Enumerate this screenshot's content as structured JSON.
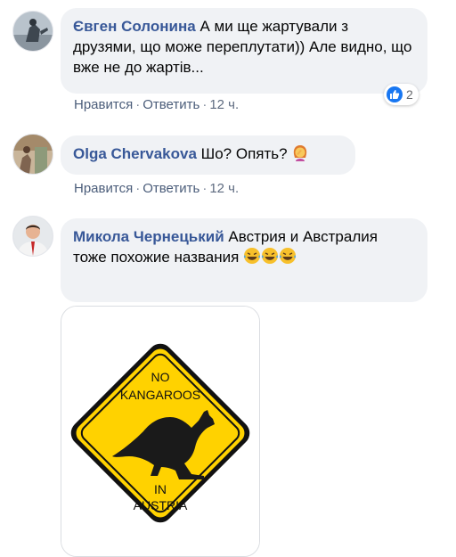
{
  "comments": [
    {
      "author": "Євген Солонина",
      "text": "А ми ще жартували з друзями, що може переплутати)) Але видно, що вже не до жартів...",
      "like_label": "Нравится",
      "reply_label": "Ответить",
      "time": "12 ч.",
      "reaction_count": "2",
      "reaction_icon": "like-icon"
    },
    {
      "author": "Olga Chervakova",
      "text": "Шо? Опять?",
      "emoji": "woman-facepalming-icon",
      "like_label": "Нравится",
      "reply_label": "Ответить",
      "time": "12 ч."
    },
    {
      "author": "Микола Чернецький",
      "text": "Австрия и Австралия тоже похожие названия",
      "emoji": "laughing-tears-icon",
      "attachment": {
        "sign_text_top_1": "NO",
        "sign_text_top_2": "KANGAROOS",
        "sign_text_bottom_1": "IN",
        "sign_text_bottom_2": "AUSTRIA",
        "sign_color": "#FFD200"
      }
    }
  ],
  "colors": {
    "author": "#385898",
    "bubble": "#f0f2f5",
    "like_blue": "#1877f2"
  }
}
